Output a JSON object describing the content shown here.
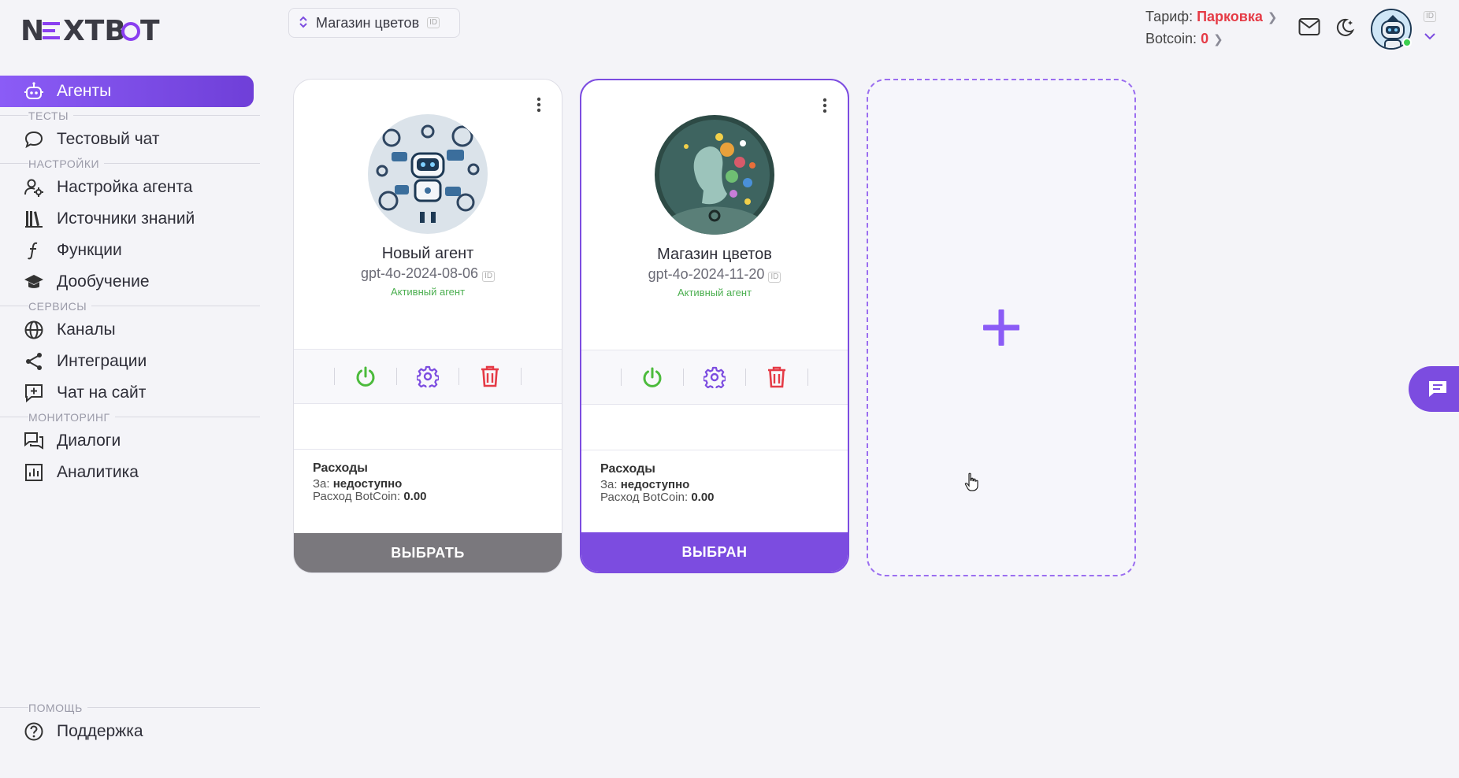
{
  "logo": {
    "text_a": "N",
    "text_b": "≡",
    "text_c": "XTB",
    "text_d": "OT"
  },
  "store_select": {
    "label": "Магазин цветов",
    "id_badge": "ID"
  },
  "account": {
    "tariff_label": "Тариф:",
    "tariff_value": "Парковка",
    "botcoin_label": "Botcoin:",
    "botcoin_value": "0",
    "avatar_id": "ID"
  },
  "sidebar": {
    "active": {
      "label": "Агенты",
      "icon": "robot-icon"
    },
    "sections": [
      {
        "title": "ТЕСТЫ",
        "items": [
          {
            "label": "Тестовый чат",
            "icon": "chat-bubble-icon"
          }
        ]
      },
      {
        "title": "НАСТРОЙКИ",
        "items": [
          {
            "label": "Настройка агента",
            "icon": "user-gear-icon"
          },
          {
            "label": "Источники знаний",
            "icon": "books-icon"
          },
          {
            "label": "Функции",
            "icon": "function-icon"
          },
          {
            "label": "Дообучение",
            "icon": "graduation-cap-icon"
          }
        ]
      },
      {
        "title": "СЕРВИСЫ",
        "items": [
          {
            "label": "Каналы",
            "icon": "globe-icon"
          },
          {
            "label": "Интеграции",
            "icon": "share-icon"
          },
          {
            "label": "Чат на сайт",
            "icon": "chat-plus-icon"
          }
        ]
      },
      {
        "title": "МОНИТОРИНГ",
        "items": [
          {
            "label": "Диалоги",
            "icon": "dialogs-icon"
          },
          {
            "label": "Аналитика",
            "icon": "analytics-icon"
          }
        ]
      }
    ],
    "help": {
      "title": "ПОМОЩЬ",
      "item": {
        "label": "Поддержка",
        "icon": "help-circle-icon"
      }
    }
  },
  "agents": [
    {
      "name": "Новый агент",
      "model": "gpt-4o-2024-08-06",
      "id_badge": "ID",
      "status": "Активный агент",
      "costs_title": "Расходы",
      "period_label": "За:",
      "period_value": "недоступно",
      "botcoin_label": "Расход BotCoin:",
      "botcoin_value": "0.00",
      "button_label": "ВЫБРАТЬ",
      "selected": false
    },
    {
      "name": "Магазин цветов",
      "model": "gpt-4o-2024-11-20",
      "id_badge": "ID",
      "status": "Активный агент",
      "costs_title": "Расходы",
      "period_label": "За:",
      "period_value": "недоступно",
      "botcoin_label": "Расход BotCoin:",
      "botcoin_value": "0.00",
      "button_label": "ВЫБРАН",
      "selected": true
    }
  ],
  "colors": {
    "accent": "#7c4ce0",
    "tariff": "#e53b46",
    "status_active": "#4caf50",
    "power": "#4cbb3c",
    "delete": "#e53b46",
    "button_gray": "#7a787d"
  }
}
